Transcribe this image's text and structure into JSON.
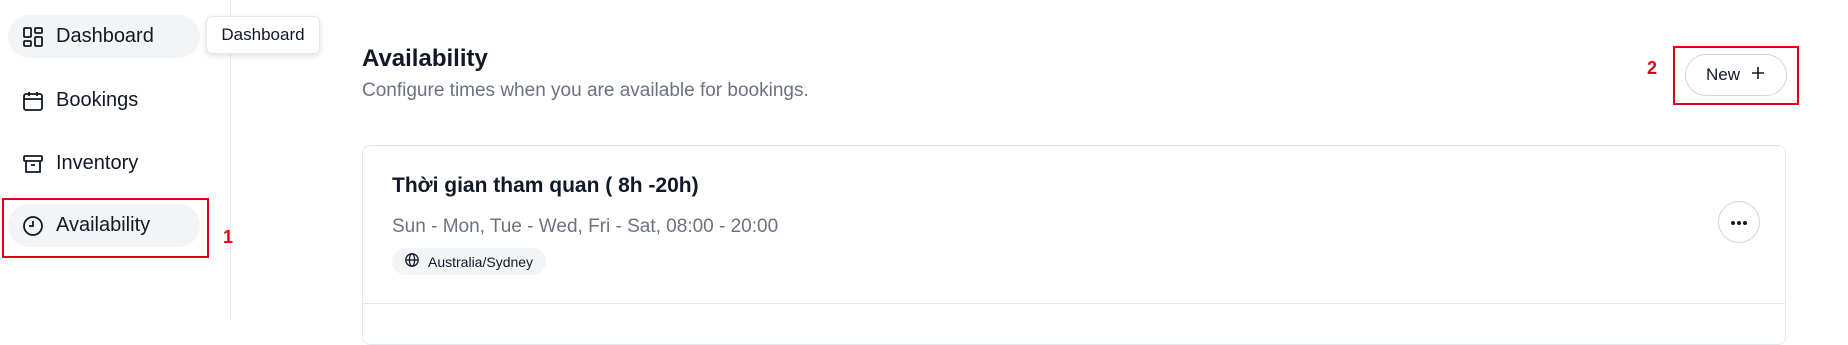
{
  "sidebar": {
    "items": [
      {
        "label": "Dashboard",
        "icon": "dashboard-grid-icon",
        "active": true
      },
      {
        "label": "Bookings",
        "icon": "calendar-icon",
        "active": false
      },
      {
        "label": "Inventory",
        "icon": "archive-box-icon",
        "active": false
      },
      {
        "label": "Availability",
        "icon": "clock-icon",
        "active": true
      }
    ]
  },
  "tooltip": {
    "text": "Dashboard"
  },
  "header": {
    "title": "Availability",
    "subtitle": "Configure times when you are available for bookings.",
    "new_button_label": "New"
  },
  "schedules": [
    {
      "title": "Thời gian tham quan ( 8h -20h)",
      "days": "Sun - Mon, Tue - Wed, Fri - Sat, 08:00 - 20:00",
      "timezone": "Australia/Sydney"
    }
  ],
  "annotations": {
    "first": "1",
    "second": "2"
  },
  "colors": {
    "annotation_red": "#e3001b",
    "text_muted": "#6b7280",
    "active_bg": "#f3f4f6"
  }
}
